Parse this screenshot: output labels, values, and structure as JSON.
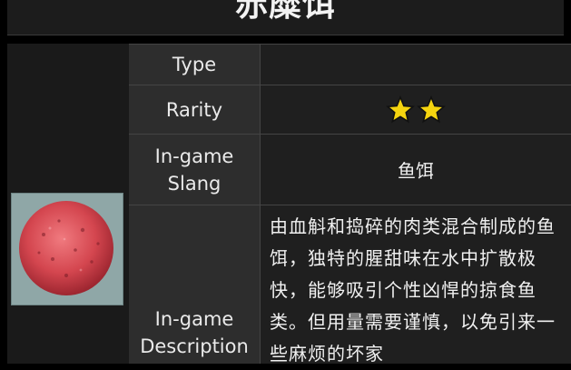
{
  "item": {
    "name": "赤糜饵"
  },
  "table": {
    "type_label": "Type",
    "type_value": "",
    "rarity_label": "Rarity",
    "rarity_stars": 2,
    "slang_label": "In-game Slang",
    "slang_value": "鱼饵",
    "description_label": "In-game Description",
    "description_value": "由血斛和捣碎的肉类混合制成的鱼饵，独特的腥甜味在水中扩散极快，能够吸引个性凶悍的掠食鱼类。但用量需要谨慎，以免引来一些麻烦的坏家"
  },
  "icons": {
    "rarity": "star-icon",
    "item": "bait-ball-image"
  },
  "colors": {
    "star": "#f5d40f",
    "label_bg": "#2d2d2d",
    "value_bg": "#1f1f1f"
  }
}
